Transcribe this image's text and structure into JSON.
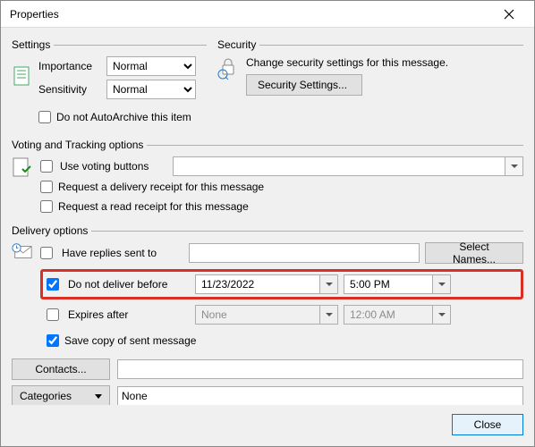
{
  "title": "Properties",
  "settings": {
    "legend": "Settings",
    "importance_label": "Importance",
    "importance_value": "Normal",
    "sensitivity_label": "Sensitivity",
    "sensitivity_value": "Normal",
    "autoarchive_label": "Do not AutoArchive this item"
  },
  "security": {
    "legend": "Security",
    "desc": "Change security settings for this message.",
    "button": "Security Settings..."
  },
  "voting": {
    "legend": "Voting and Tracking options",
    "use_voting_label": "Use voting buttons",
    "delivery_receipt_label": "Request a delivery receipt for this message",
    "read_receipt_label": "Request a read receipt for this message"
  },
  "delivery": {
    "legend": "Delivery options",
    "have_replies_label": "Have replies sent to",
    "select_names": "Select Names...",
    "do_not_deliver_label": "Do not deliver before",
    "do_not_deliver_date": "11/23/2022",
    "do_not_deliver_time": "5:00 PM",
    "expires_after_label": "Expires after",
    "expires_date": "None",
    "expires_time": "12:00 AM",
    "save_copy_label": "Save copy of sent message"
  },
  "bottom": {
    "contacts": "Contacts...",
    "categories": "Categories",
    "categories_value": "None"
  },
  "close": "Close"
}
